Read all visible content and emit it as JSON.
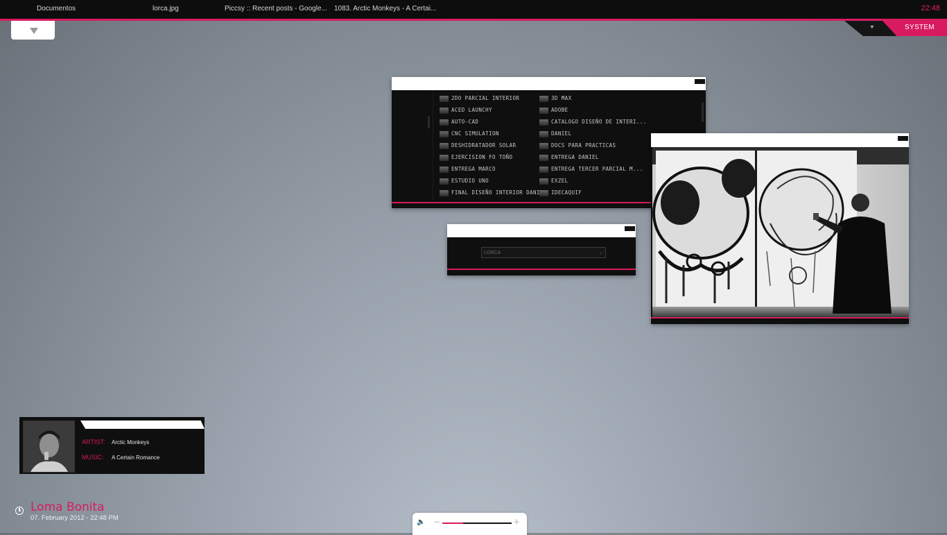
{
  "taskbar": {
    "tasks": [
      {
        "label": "Documentos"
      },
      {
        "label": "lorca.jpg"
      },
      {
        "label": "Piccsy :: Recent posts - Google..."
      },
      {
        "label": "1083. Arctic Monkeys - A Certai..."
      }
    ],
    "clock": "22:48"
  },
  "system_panel": {
    "plus": "+",
    "label": "SYSTEM"
  },
  "folder_window": {
    "left_column": [
      "2DO PARCIAL INTERIOR",
      "ACED LAUNCHY",
      "AUTO-CAD",
      "CNC SIMULATION",
      "DESHIDRATADOR SOLAR",
      "EJERCISION FO TOÑO",
      "ENTREGA MARCO",
      "ESTUDIO UNO",
      "FINAL DISEÑO INTERIOR DANIEL"
    ],
    "right_column": [
      "3D MAX",
      "ADOBE",
      "CATALOGO DISEÑO DE INTERI...",
      "DANIEL",
      "DOCS PARA PRACTICAS",
      "ENTREGA DANIEL",
      "ENTREGA TERCER PARCIAL M...",
      "EXZEL",
      "IDECAQUIF"
    ],
    "folder_icon": "folder-icon"
  },
  "search_window": {
    "value": "LORCA"
  },
  "music": {
    "artist_key": "ARTIST:",
    "artist": "Arctic Monkeys",
    "music_key": "MUSIC:",
    "title": "A Certain Romance"
  },
  "location_clock": {
    "city": "Loma Bonita",
    "datetime": "07. February 2012 - 22:48 PM"
  },
  "volume": {
    "level": 0.3
  },
  "colors": {
    "accent": "#d81b60",
    "panel": "#0f0f0f"
  }
}
